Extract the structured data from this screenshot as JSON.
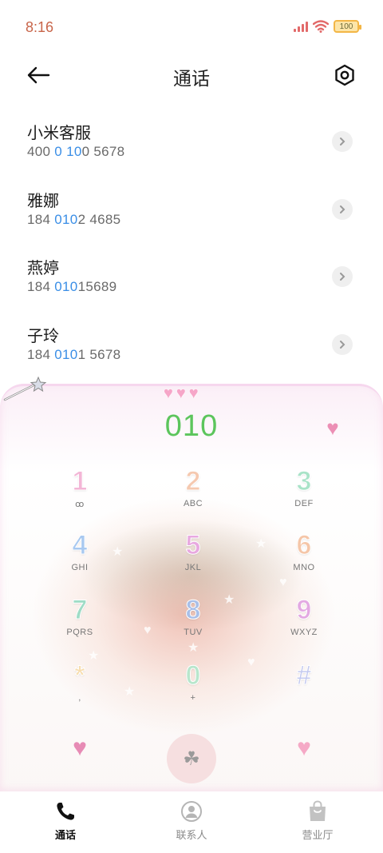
{
  "status_bar": {
    "time": "8:16",
    "battery": "100"
  },
  "header": {
    "title": "通话"
  },
  "results": [
    {
      "name": "小米客服",
      "num_pre": "400 ",
      "num_hl": "0 10",
      "num_post": "0 5678"
    },
    {
      "name": "雅娜",
      "num_pre": "184 ",
      "num_hl": "010",
      "num_post": "2 4685"
    },
    {
      "name": "燕婷",
      "num_pre": "184 ",
      "num_hl": "010",
      "num_post": "15689"
    },
    {
      "name": "子玲",
      "num_pre": "184 ",
      "num_hl": "010",
      "num_post": "1 5678"
    }
  ],
  "dialer": {
    "input": "010",
    "keys": [
      {
        "digit": "1",
        "letters": "ꝏ",
        "color": "#f3b6d6"
      },
      {
        "digit": "2",
        "letters": "ABC",
        "color": "#f5c9b0"
      },
      {
        "digit": "3",
        "letters": "DEF",
        "color": "#a9e3c8"
      },
      {
        "digit": "4",
        "letters": "GHI",
        "color": "#a9c9f0"
      },
      {
        "digit": "5",
        "letters": "JKL",
        "color": "#e8a9e0"
      },
      {
        "digit": "6",
        "letters": "MNO",
        "color": "#f5c6a8"
      },
      {
        "digit": "7",
        "letters": "PQRS",
        "color": "#9fdcc6"
      },
      {
        "digit": "8",
        "letters": "TUV",
        "color": "#a8bfe8"
      },
      {
        "digit": "9",
        "letters": "WXYZ",
        "color": "#e3a9e2"
      },
      {
        "digit": "*",
        "letters": ",",
        "color": "#f7ddb0"
      },
      {
        "digit": "0",
        "letters": "+",
        "color": "#b8e6cc"
      },
      {
        "digit": "#",
        "letters": "",
        "color": "#c3c9ef"
      }
    ]
  },
  "nav": {
    "tabs": [
      {
        "label": "通话"
      },
      {
        "label": "联系人"
      },
      {
        "label": "营业厅"
      }
    ]
  }
}
